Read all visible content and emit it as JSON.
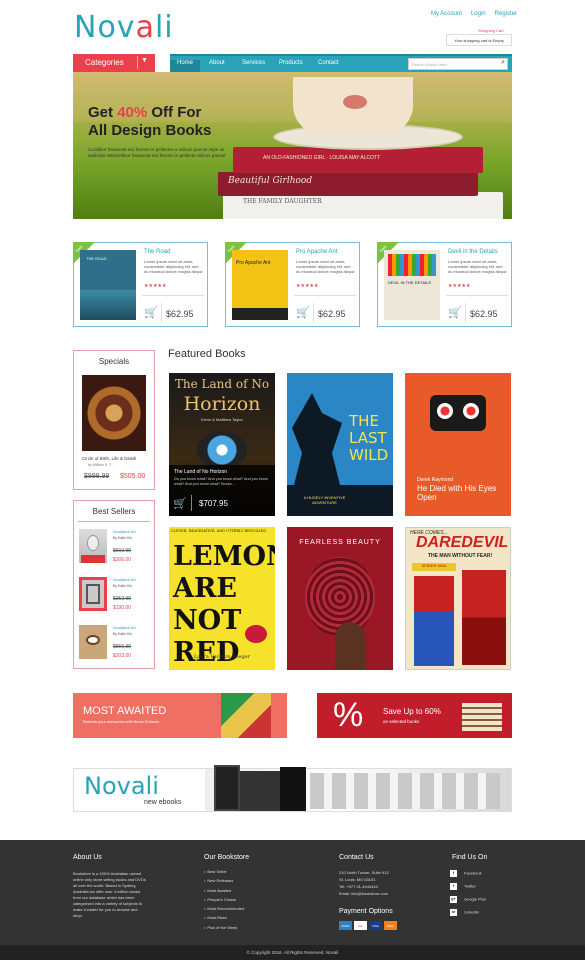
{
  "header": {
    "logo": {
      "part1": "Nov",
      "part2": "a",
      "part3": "li"
    },
    "links": [
      "My Account",
      "Login",
      "Register"
    ],
    "cart": {
      "title": "Shopping Cart",
      "text": "Your shopping cart is Empty"
    }
  },
  "nav": {
    "categories_label": "Categories",
    "items": [
      "Home",
      "About",
      "Services",
      "Products",
      "Contact"
    ],
    "search_placeholder": "Search Books Here..."
  },
  "hero": {
    "line1a": "Get ",
    "line1b": "40%",
    "line1c": " Off For",
    "line2": "All Design Books",
    "text": "Curabitur freasenet nisi feorem in pellentes a vidicus pannel impe us sadimtar vetraretbitur freasenet nisi feorem in pellente vidicus pannel",
    "book_titles": [
      "AN OLD-FASHIONED GIRL · LOUISA MAY ALCOTT",
      "Beautiful Girlhood",
      "THE FAMILY DAUGHTER"
    ]
  },
  "products": [
    {
      "badge": "Sale",
      "title": "The Road",
      "desc": "Lorem ipsum dolor sit amet, consectetur adipiscing elit, sed do eiusmod dolore magna aliqua",
      "stars": "★★★★★",
      "price": "$62.95",
      "cover_title": "THE ROAD",
      "cover_color": "#2f6f8a"
    },
    {
      "badge": "Sale",
      "title": "Pro Apache Ant",
      "desc": "Lorem ipsum dolor sit amet, consectetur adipiscing elit, sed do eiusmod dolore magna aliqua",
      "stars": "★★★★★",
      "price": "$62.95",
      "cover_title": "Pro Apache Ant",
      "cover_color": "#f2c215"
    },
    {
      "badge": "Sale",
      "title": "Devil in the Details",
      "desc": "Lorem ipsum dolor sit amet, consectetur adipiscing elit, sed do eiusmod dolore magna aliqua",
      "stars": "★★★★★",
      "price": "$62.95",
      "cover_title": "DEVIL IN THE DETAILS",
      "cover_color": "#ede7da"
    }
  ],
  "specials": {
    "heading": "Specials",
    "name": "Circle of Birth, Life & Death",
    "author": "by William K. T",
    "old_price": "$999.99",
    "price": "$505.00"
  },
  "bestsellers": {
    "heading": "Best Sellers",
    "items": [
      {
        "name": "Sculpture Art",
        "author": "By Kathi Klo",
        "old": "$602.99",
        "price": "$306.00"
      },
      {
        "name": "Sculpture Art",
        "author": "By Kathi Klo",
        "old": "$352.99",
        "price": "$190.00"
      },
      {
        "name": "Sculpture Art",
        "author": "By Kathi Klo",
        "old": "$556.99",
        "price": "$203.00"
      }
    ]
  },
  "featured": {
    "heading": "Featured Books",
    "tile1": {
      "line1": "The Land of No",
      "line2": "Horizon",
      "authors": "Kevin & Matthew Taylor",
      "caption": "The Land of No Horizon",
      "text": "Do you know what? And you know what? And you know what? And you know what? Books...",
      "price": "$707.95"
    },
    "tile2": {
      "line1": "THE",
      "line2": "LAST",
      "line3": "WILD",
      "tag": "A HUGELY INVENTIVE ADVENTURE"
    },
    "tile3": {
      "author": "Derek Raymond",
      "title": "He Died with His Eyes Open"
    },
    "tile4": {
      "top": "CLEVER, IMAGINATIVE, AND UTTERLY BEGUILING",
      "line1": "LEMONS",
      "line2": "ARE NOT",
      "line3": "RED",
      "author": "Laura Vaccaro Seeger"
    },
    "tile5": {
      "title": "FEARLESS BEAUTY"
    },
    "tile6": {
      "top": "HERE COMES...",
      "title": "DAREDEVIL",
      "sub": "THE MAN WITHOUT FEAR!",
      "spider": "SPIDER MAN"
    }
  },
  "promo": {
    "left_title": "MOST AWAITED",
    "left_sub": "Refresh your memories with these Editions",
    "right_title": "Save Up to 60%",
    "right_sub": "on selected books",
    "ebooks_logo": "Novali",
    "ebooks_sub": "new ebooks"
  },
  "footer": {
    "about_h": "About Us",
    "about_text": "Bookstore is a 100% Australian owned online only store selling books and DVDs all over the world. Based in Sydney, Australia we offer over 4 million books from our database which has been categorised into a variety of subjects to make it easier for you to browse and shop.",
    "store_h": "Our Bookstore",
    "store_items": [
      "Best Seller",
      "New Releases",
      "Most Awaited",
      "People's Choice",
      "Most Recommended",
      "Must Read",
      "Pick of the Week"
    ],
    "contact_h": "Contact Us",
    "contact_lines": [
      "210 North Tucker, Suite 913",
      "St. Louis, MO 63101",
      "Tel: +977 01-4444444",
      "Email: info@bookstore.com"
    ],
    "payment_h": "Payment Options",
    "payment_cards": [
      "AMEX",
      "MC",
      "VISA",
      "DISC"
    ],
    "find_h": "Find Us On",
    "social": [
      {
        "icon": "f",
        "label": "Facebook"
      },
      {
        "icon": "t",
        "label": "Twitter"
      },
      {
        "icon": "g+",
        "label": "Google Plus"
      },
      {
        "icon": "in",
        "label": "Linkedin"
      }
    ],
    "copyright": "© Copyright 2016. All Rights Reserved. Novali"
  },
  "colors": {
    "brand": "#29a3b8",
    "accent": "#e8414c",
    "footer": "#333333"
  }
}
